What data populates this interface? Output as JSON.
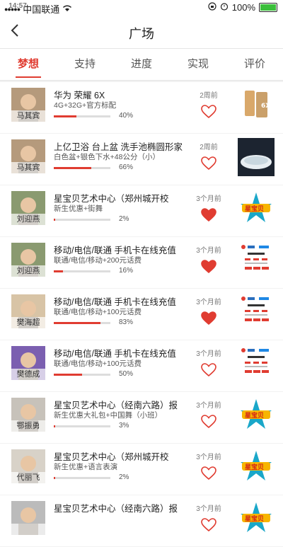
{
  "status": {
    "carrier": "中国联通",
    "time": "14:57",
    "battery": "100%"
  },
  "nav": {
    "title": "广场"
  },
  "tabs": [
    "梦想",
    "支持",
    "进度",
    "实现",
    "评价"
  ],
  "colors": {
    "accent": "#e03c31",
    "track": "#dddddd"
  },
  "items": [
    {
      "name": "马其宾",
      "title": "华为 荣耀 6X",
      "sub": "4G+32G+官方标配",
      "progress": 40,
      "pct": "40%",
      "time": "2周前",
      "liked": false,
      "thumb": "phone"
    },
    {
      "name": "马其宾",
      "title": "上亿卫浴 台上盆 洗手池椭圆形家",
      "sub": "白色盆+银色下水+48公分（小）",
      "progress": 66,
      "pct": "66%",
      "time": "2周前",
      "liked": false,
      "thumb": "basin"
    },
    {
      "name": "刘迎燕",
      "title": "星宝贝艺术中心（郑州城开校",
      "sub": "新生优惠+街舞",
      "progress": 2,
      "pct": "2%",
      "time": "3个月前",
      "liked": true,
      "thumb": "star"
    },
    {
      "name": "刘迎燕",
      "title": "移动/电信/联通 手机卡在线充值",
      "sub": "联通/电信/移动+200元话费",
      "progress": 16,
      "pct": "16%",
      "time": "3个月前",
      "liked": true,
      "thumb": "card"
    },
    {
      "name": "樊海超",
      "title": "移动/电信/联通 手机卡在线充值",
      "sub": "联通/电信/移动+100元话费",
      "progress": 83,
      "pct": "83%",
      "time": "3个月前",
      "liked": true,
      "thumb": "card"
    },
    {
      "name": "樊德成",
      "title": "移动/电信/联通 手机卡在线充值",
      "sub": "联通/电信/移动+100元话费",
      "progress": 50,
      "pct": "50%",
      "time": "3个月前",
      "liked": false,
      "thumb": "card"
    },
    {
      "name": "鄂振勇",
      "title": "星宝贝艺术中心（经南六路）报",
      "sub": "新生优惠大礼包+中国舞（小班）",
      "progress": 3,
      "pct": "3%",
      "time": "3个月前",
      "liked": false,
      "thumb": "star"
    },
    {
      "name": "代丽飞",
      "title": "星宝贝艺术中心（郑州城开校",
      "sub": "新生优惠+语言表演",
      "progress": 2,
      "pct": "2%",
      "time": "3个月前",
      "liked": false,
      "thumb": "star"
    },
    {
      "name": "",
      "title": "星宝贝艺术中心（经南六路）报",
      "sub": "",
      "progress": 0,
      "pct": "",
      "time": "3个月前",
      "liked": false,
      "thumb": "star"
    }
  ]
}
